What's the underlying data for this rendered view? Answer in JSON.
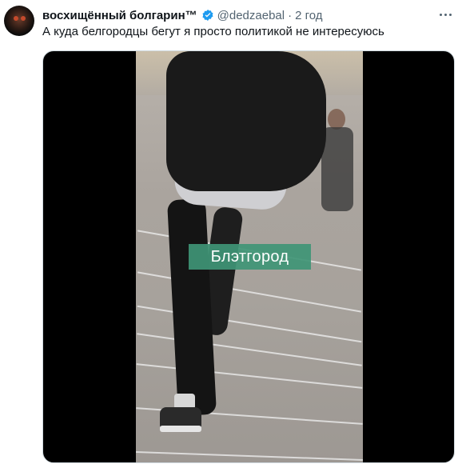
{
  "tweet": {
    "display_name": "восхищённый болгарин™",
    "handle": "@dedzaebal",
    "separator": "·",
    "time": "2 год",
    "text": "А куда белгородцы бегут я просто политикой не интересуюсь",
    "verified": true,
    "more_icon": "more-horizontal-icon"
  },
  "media": {
    "caption": "Блэтгород"
  },
  "colors": {
    "name": "#0f1419",
    "secondary": "#536471",
    "verified": "#1d9bf0",
    "caption_bg": "#3f9576"
  }
}
